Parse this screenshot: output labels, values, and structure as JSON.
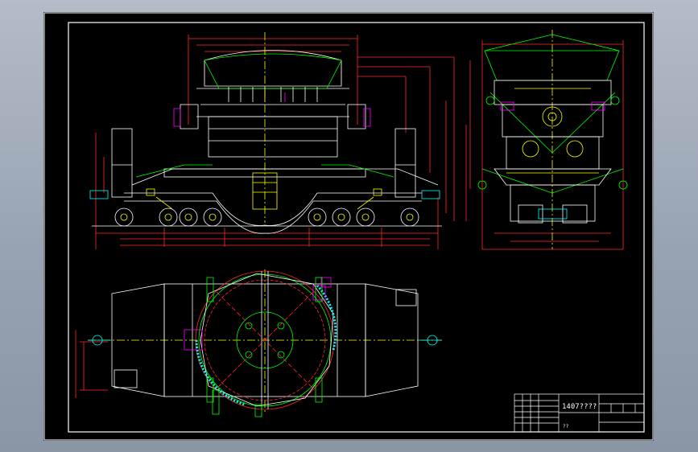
{
  "drawing": {
    "title_block": {
      "drawing_number": "1407????",
      "sheet_label": "??"
    },
    "colors": {
      "background": "#000000",
      "frame": "#ffffff",
      "geometry": "#ffffff",
      "dimension": "#ff2a2a",
      "centerline": "#ffff00",
      "construction": "#00ff00",
      "detail": "#ff00ff",
      "hatch": "#00ffff"
    }
  }
}
